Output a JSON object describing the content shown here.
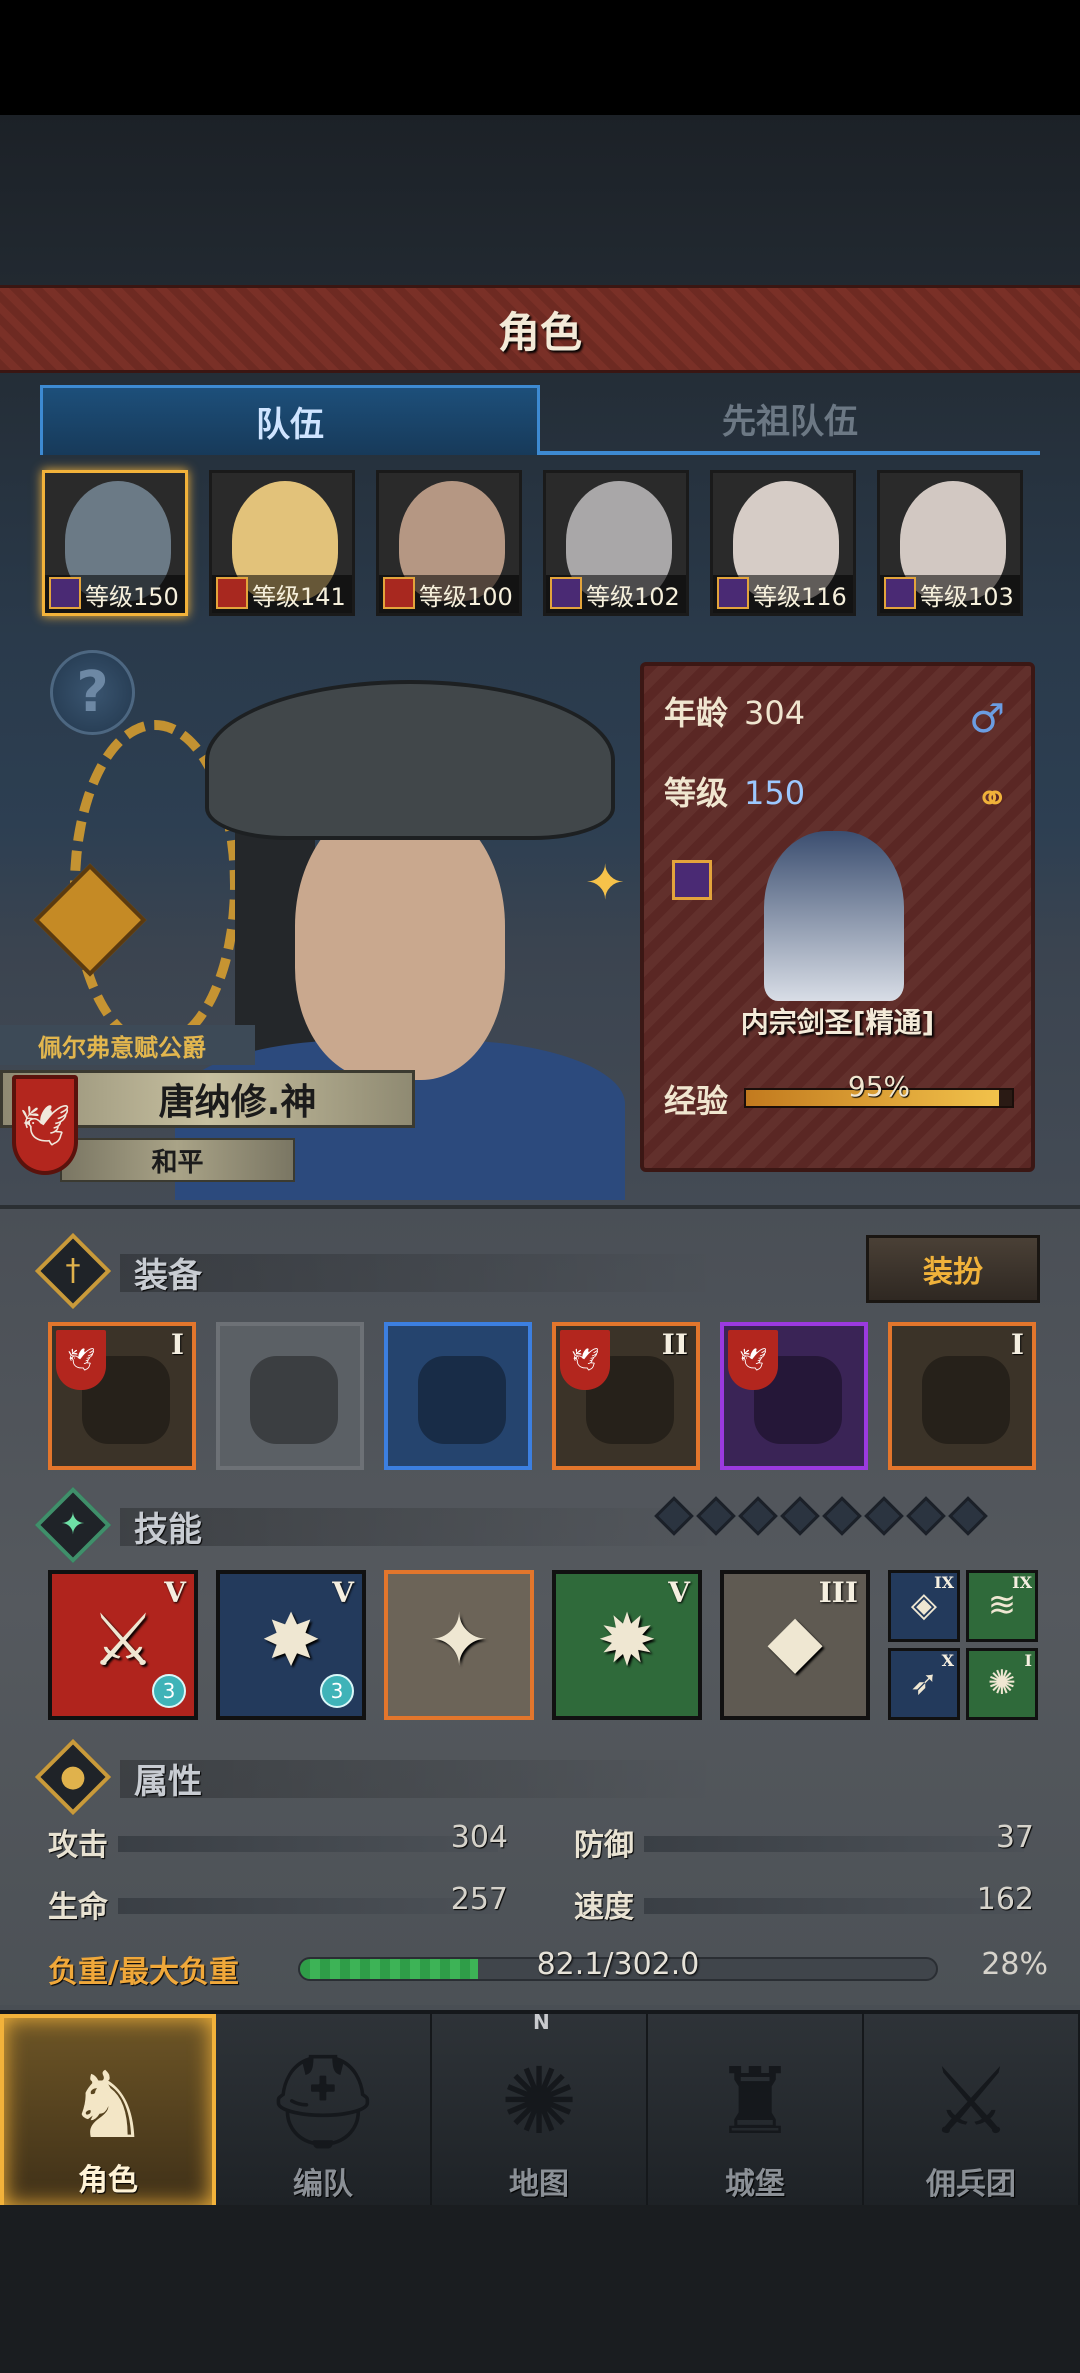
{
  "screen": {
    "title": "角色",
    "tabs": [
      {
        "label": "队伍",
        "active": true
      },
      {
        "label": "先祖队伍",
        "active": false
      }
    ]
  },
  "team": [
    {
      "level": "等级150",
      "selected": true,
      "face_color": "#6b7a86"
    },
    {
      "level": "等级141",
      "selected": false,
      "face_color": "#e2c27a"
    },
    {
      "level": "等级100",
      "selected": false,
      "face_color": "#b59783"
    },
    {
      "level": "等级102",
      "selected": false,
      "face_color": "#a9a7a8"
    },
    {
      "level": "等级116",
      "selected": false,
      "face_color": "#d6ccc6"
    },
    {
      "level": "等级103",
      "selected": false,
      "face_color": "#d2c8c2"
    }
  ],
  "hero": {
    "title": "佩尔弗意赋公爵",
    "name": "唐纳修.神",
    "status": "和平",
    "age_label": "年龄",
    "age": "304",
    "level_label": "等级",
    "level": "150",
    "class_name": "内宗剑圣[精通]",
    "xp_label": "经验",
    "xp_percent_text": "95%",
    "xp_fraction": 0.95,
    "gender_icon": "male-icon",
    "marriage_icon": "ring-icon"
  },
  "equipment": {
    "label": "装备",
    "dress_button": "装扮",
    "slots": [
      {
        "name": "gauntlet",
        "rank": "I",
        "rarity": "orange",
        "banner": true
      },
      {
        "name": "empty-shield",
        "rank": "",
        "rarity": "empty",
        "banner": false
      },
      {
        "name": "hood",
        "rank": "",
        "rarity": "blue",
        "banner": false
      },
      {
        "name": "armor",
        "rank": "II",
        "rarity": "orange",
        "banner": true
      },
      {
        "name": "boots",
        "rank": "",
        "rarity": "purple",
        "banner": true
      },
      {
        "name": "tome",
        "rank": "I",
        "rarity": "orange",
        "banner": false
      }
    ]
  },
  "skills": {
    "label": "技能",
    "pip_count": 8,
    "list": [
      {
        "rank": "V",
        "bg": "#b0241d",
        "glyph": "⚔",
        "badge": "3"
      },
      {
        "rank": "V",
        "bg": "#233a5c",
        "glyph": "✸",
        "badge": "3"
      },
      {
        "rank": "",
        "bg": "#6c6458",
        "glyph": "✦",
        "badge": ""
      },
      {
        "rank": "V",
        "bg": "#2f6a3a",
        "glyph": "✹",
        "badge": ""
      },
      {
        "rank": "III",
        "bg": "#5f5a52",
        "glyph": "◆",
        "badge": ""
      }
    ],
    "mini": [
      {
        "rank": "IX",
        "bg": "#233a5c",
        "glyph": "◈"
      },
      {
        "rank": "IX",
        "bg": "#2f6a3a",
        "glyph": "≋"
      },
      {
        "rank": "X",
        "bg": "#233a5c",
        "glyph": "➶"
      },
      {
        "rank": "I",
        "bg": "#2f6a3a",
        "glyph": "✺"
      }
    ]
  },
  "attributes": {
    "label": "属性",
    "attack_label": "攻击",
    "attack": "304",
    "defense_label": "防御",
    "defense": "37",
    "hp_label": "生命",
    "hp": "257",
    "speed_label": "速度",
    "speed": "162",
    "load_label": "负重/最大负重",
    "load_text": "82.1/302.0",
    "load_percent": "28%",
    "load_fraction": 0.28
  },
  "nav": [
    {
      "label": "角色",
      "active": true,
      "icon": "knight-icon"
    },
    {
      "label": "编队",
      "active": false,
      "icon": "helmet-icon"
    },
    {
      "label": "地图",
      "active": false,
      "icon": "compass-icon"
    },
    {
      "label": "城堡",
      "active": false,
      "icon": "castle-icon"
    },
    {
      "label": "佣兵团",
      "active": false,
      "icon": "mercenary-icon"
    }
  ],
  "compass_north": "N"
}
